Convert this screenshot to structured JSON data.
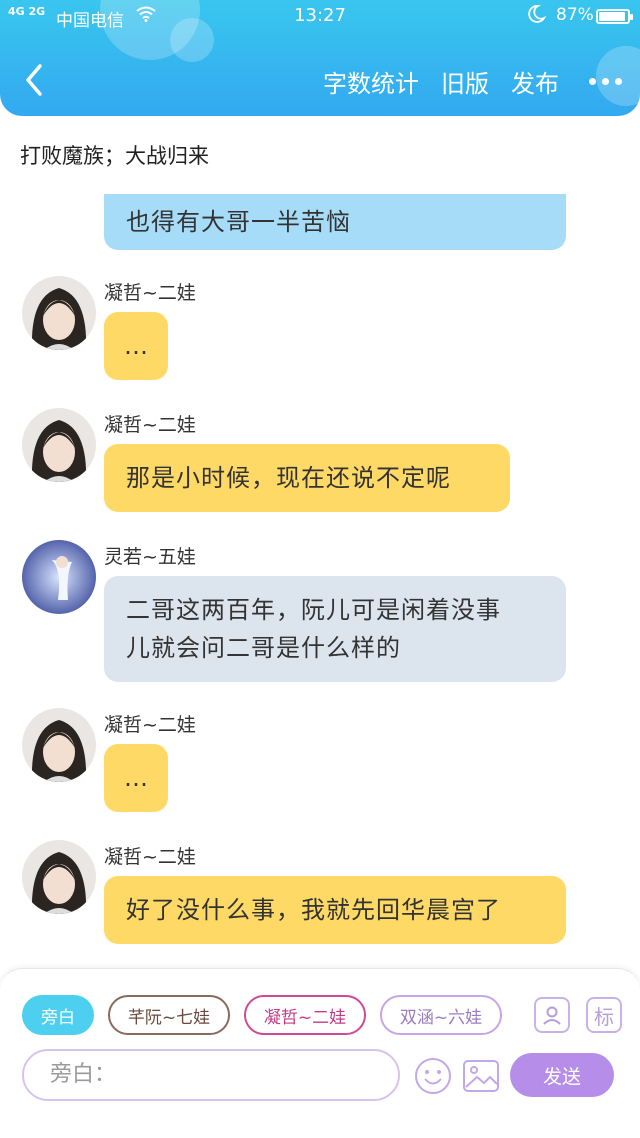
{
  "status_bar": {
    "network": "4G 2G",
    "carrier": "中国电信",
    "time": "13:27",
    "battery": "87%"
  },
  "header": {
    "word_count": "字数统计",
    "old_version": "旧版",
    "publish": "发布"
  },
  "chapter_title": "打败魔族；大战归来",
  "messages": [
    {
      "type": "partial",
      "text": "也得有大哥一半苦恼"
    },
    {
      "name": "凝哲~二娃",
      "text": "…"
    },
    {
      "name": "凝哲~二娃",
      "text": "那是小时候，现在还说不定呢"
    },
    {
      "name": "灵若~五娃",
      "line1": "二哥这两百年，阮儿可是闲着没事",
      "line2": "儿就会问二哥是什么样的"
    },
    {
      "name": "凝哲~二娃",
      "text": "…"
    },
    {
      "name": "凝哲~二娃",
      "text": "好了没什么事，我就先回华晨宫了"
    }
  ],
  "roles": [
    "旁白",
    "芊阮~七娃",
    "凝哲~二娃",
    "双涵~六娃"
  ],
  "tools": {
    "role_mark": "标"
  },
  "input": {
    "placeholder": "旁白："
  },
  "send_label": "发送",
  "colors": {
    "header": "#36b8f0",
    "bubble_yellow": "#ffd966",
    "bubble_blue": "#a6dcf8",
    "bubble_gray": "#dce4ed",
    "send": "#b68de8"
  }
}
